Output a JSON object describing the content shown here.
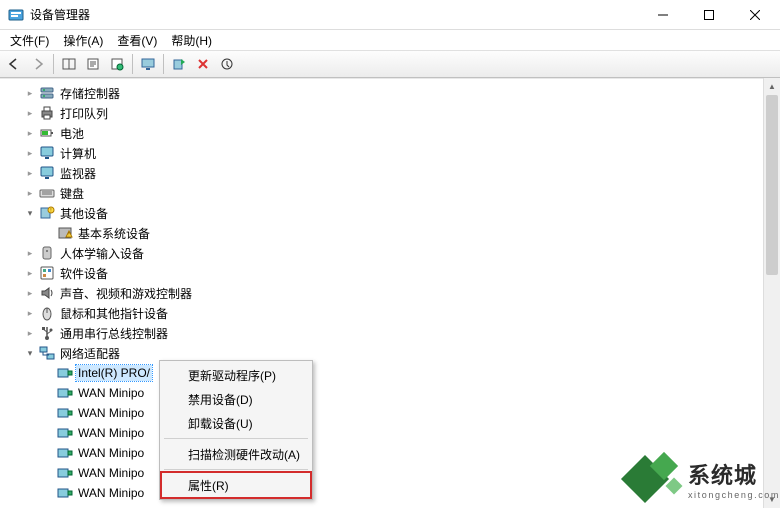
{
  "window": {
    "title": "设备管理器"
  },
  "menu": {
    "file": "文件(F)",
    "action": "操作(A)",
    "view": "查看(V)",
    "help": "帮助(H)"
  },
  "tree": {
    "items": [
      {
        "label": "存储控制器",
        "icon": "storage"
      },
      {
        "label": "打印队列",
        "icon": "printer"
      },
      {
        "label": "电池",
        "icon": "battery"
      },
      {
        "label": "计算机",
        "icon": "monitor"
      },
      {
        "label": "监视器",
        "icon": "monitor"
      },
      {
        "label": "键盘",
        "icon": "keyboard"
      },
      {
        "label": "其他设备",
        "icon": "unknown",
        "expanded": true,
        "children": [
          {
            "label": "基本系统设备",
            "icon": "warning"
          }
        ]
      },
      {
        "label": "人体学输入设备",
        "icon": "hid"
      },
      {
        "label": "软件设备",
        "icon": "software"
      },
      {
        "label": "声音、视频和游戏控制器",
        "icon": "speaker"
      },
      {
        "label": "鼠标和其他指针设备",
        "icon": "mouse"
      },
      {
        "label": "通用串行总线控制器",
        "icon": "usb"
      },
      {
        "label": "网络适配器",
        "icon": "network",
        "expanded": true,
        "children": [
          {
            "label": "Intel(R) PRO/",
            "icon": "nic",
            "selected": true
          },
          {
            "label": "WAN Minipo",
            "icon": "nic"
          },
          {
            "label": "WAN Minipo",
            "icon": "nic"
          },
          {
            "label": "WAN Minipo",
            "icon": "nic"
          },
          {
            "label": "WAN Minipo",
            "icon": "nic"
          },
          {
            "label": "WAN Minipo",
            "icon": "nic"
          },
          {
            "label": "WAN Minipo",
            "icon": "nic"
          }
        ]
      }
    ]
  },
  "context_menu": {
    "update_driver": "更新驱动程序(P)",
    "disable": "禁用设备(D)",
    "uninstall": "卸载设备(U)",
    "scan": "扫描检测硬件改动(A)",
    "properties": "属性(R)"
  },
  "watermark": {
    "cn": "系统城",
    "en": "xitongcheng.com"
  }
}
